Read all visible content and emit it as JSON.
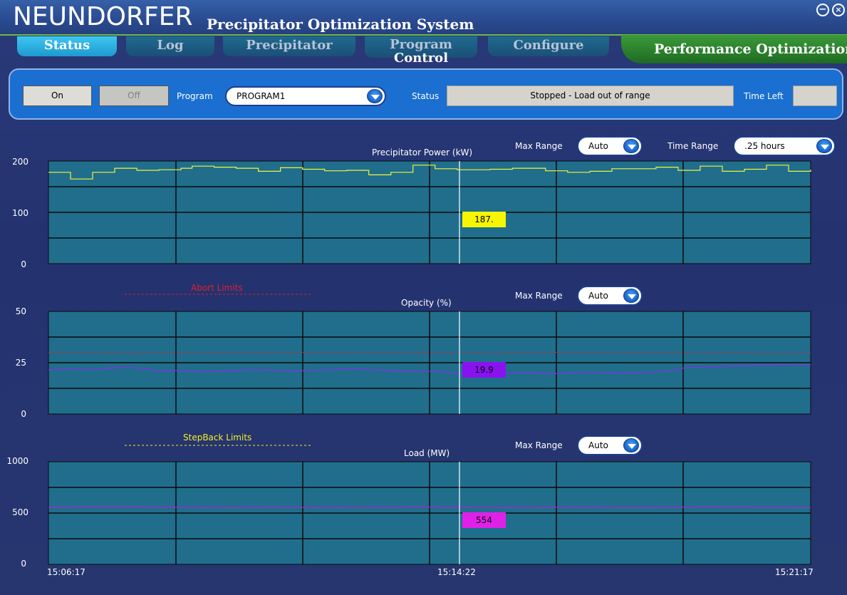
{
  "app": {
    "brand": "NEUNDORFER",
    "subtitle": "Precipitator Optimization System",
    "minimize_icon": "minimize-icon",
    "close_icon": "close-icon"
  },
  "tabs": [
    {
      "label": "Status",
      "active": true
    },
    {
      "label": "Log",
      "active": false
    },
    {
      "label": "Precipitator",
      "active": false
    },
    {
      "label_line1": "Program",
      "label_line2": "Control",
      "active": false
    },
    {
      "label": "Configure",
      "active": false
    }
  ],
  "perf_tab": {
    "label": "Performance Optimization"
  },
  "control": {
    "on_label": "On",
    "off_label": "Off",
    "program_label": "Program",
    "program_value": "PROGRAM1",
    "status_label": "Status",
    "status_value": "Stopped - Load out of range",
    "time_left_label": "Time Left",
    "time_left_value": ""
  },
  "chart_controls": {
    "max_range_label": "Max Range",
    "max_range_value": "Auto",
    "time_range_label": "Time Range",
    "time_range_value": ".25 hours"
  },
  "limits": {
    "abort_label": "Abort Limits",
    "stepback_label": "StepBack Limits",
    "abort_color": "#e0202a",
    "stepback_color": "#f0f020"
  },
  "x_axis": {
    "ticks": [
      "15:06:17",
      "15:14:22",
      "15:21:17"
    ]
  },
  "chart_data": [
    {
      "type": "line",
      "title": "Precipitator Power (kW)",
      "ylim": [
        0,
        200
      ],
      "yticks": [
        "200",
        "100",
        "0"
      ],
      "cursor_value": "187.",
      "color": "#f2f23a",
      "series": [
        {
          "values": [
            178,
            178,
            165,
            165,
            178,
            178,
            186,
            186,
            182,
            182,
            183,
            183,
            186,
            190,
            190,
            188,
            188,
            186,
            186,
            180,
            180,
            187,
            187,
            184,
            184,
            181,
            181,
            182,
            182,
            173,
            173,
            178,
            178,
            192,
            192,
            185,
            185,
            183,
            183,
            183,
            184,
            184,
            186,
            186,
            186,
            181,
            181,
            178,
            178,
            180,
            180,
            185,
            185,
            185,
            185,
            188,
            188,
            182,
            182,
            190,
            190,
            180,
            180,
            184,
            184,
            192,
            192,
            180,
            180,
            183
          ]
        }
      ]
    },
    {
      "type": "line",
      "title": "Opacity (%)",
      "ylim": [
        0,
        50
      ],
      "yticks": [
        "50",
        "25",
        "0"
      ],
      "cursor_value": "19.9",
      "color": "#8a2cf0",
      "abort_limit": 30,
      "series": [
        {
          "values": [
            21.5,
            22,
            21.8,
            21.6,
            22.4,
            22.8,
            22.2,
            21,
            21.2,
            20.8,
            20.6,
            20.8,
            21.2,
            21.6,
            21.4,
            21.2,
            21.0,
            21.3,
            21.6,
            21.9,
            22.1,
            21.4,
            21.2,
            20.8,
            20.6,
            20.9,
            19.9,
            19.6,
            19.4,
            19.8,
            20.2,
            20.0,
            19.6,
            19.8,
            20.2,
            20.4,
            20.0,
            19.8,
            20.2,
            20.4,
            21.2,
            22.6,
            22.8,
            23.0,
            23.4,
            23.6,
            23.8,
            24.0,
            24.2,
            24.0
          ]
        }
      ]
    },
    {
      "type": "line",
      "title": "Load (MW)",
      "ylim": [
        0,
        1000
      ],
      "yticks": [
        "1000",
        "500",
        "0"
      ],
      "cursor_value": "554",
      "color": "#b020d8",
      "series": [
        {
          "values": [
            556,
            558,
            560,
            562,
            560,
            558,
            556,
            554,
            553,
            554,
            555,
            556,
            556,
            555,
            554,
            553,
            554,
            556,
            558,
            560,
            558,
            556,
            554,
            553,
            552,
            554,
            556,
            558,
            556,
            554,
            554,
            555,
            556,
            558,
            560,
            559,
            558,
            556,
            555,
            554
          ]
        }
      ]
    }
  ]
}
